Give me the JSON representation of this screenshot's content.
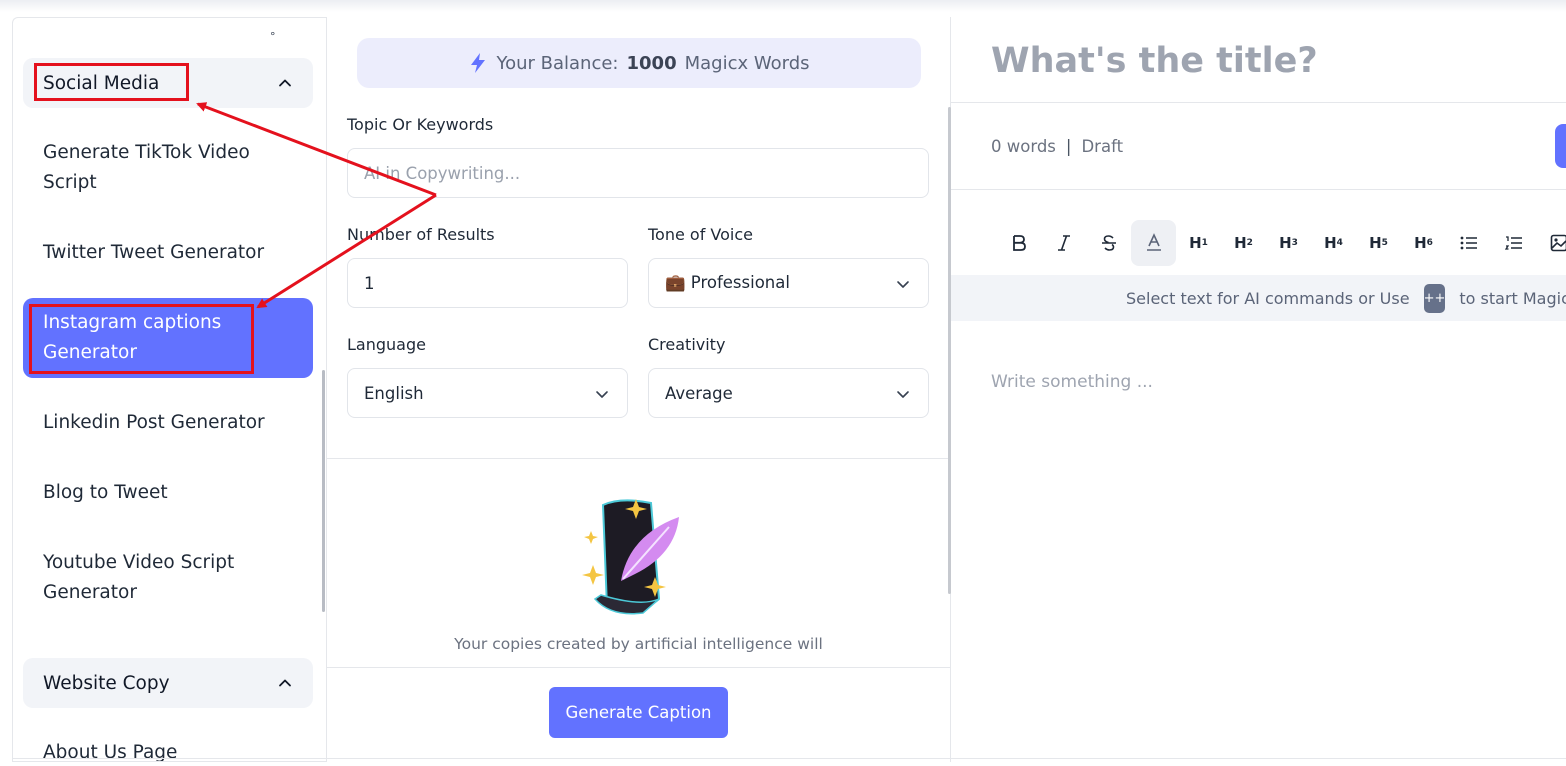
{
  "sidebar": {
    "dot": "°",
    "categories": [
      {
        "label": "Social Media",
        "expanded": true
      },
      {
        "label": "Website Copy",
        "expanded": true
      }
    ],
    "items": [
      {
        "label": "Generate TikTok Video Script"
      },
      {
        "label": "Twitter Tweet Generator"
      },
      {
        "label": "Instagram captions Generator",
        "active": true
      },
      {
        "label": "Linkedin Post Generator"
      },
      {
        "label": "Blog to Tweet"
      },
      {
        "label": "Youtube Video Script Generator"
      },
      {
        "label": "About Us Page Copywriting"
      }
    ]
  },
  "form": {
    "balance": {
      "prefix": "Your Balance:",
      "amount": "1000",
      "suffix": "Magicx Words"
    },
    "topic": {
      "label": "Topic Or Keywords",
      "placeholder": "AI in Copywriting..."
    },
    "results": {
      "label": "Number of Results",
      "value": "1"
    },
    "tone": {
      "label": "Tone of Voice",
      "value": "💼 Professional"
    },
    "language": {
      "label": "Language",
      "value": "English"
    },
    "creativity": {
      "label": "Creativity",
      "value": "Average"
    },
    "empty_message": "Your copies created by artificial intelligence will",
    "generate_label": "Generate Caption"
  },
  "editor": {
    "title_placeholder": "What's the title?",
    "word_count": "0 words",
    "separator": "|",
    "status": "Draft",
    "toolbar": [
      "bold-icon",
      "italic-icon",
      "strikethrough-icon",
      "text-color-icon",
      "h1",
      "h2",
      "h3",
      "h4",
      "h5",
      "h6",
      "bullet-list-icon",
      "ordered-list-icon",
      "image-icon"
    ],
    "hint_before": "Select text for AI commands or Use",
    "hint_key": "++",
    "hint_after": "to start Magic",
    "body_placeholder": "Write something ..."
  },
  "colors": {
    "accent": "#6272ff",
    "annotation": "#e4111d"
  }
}
